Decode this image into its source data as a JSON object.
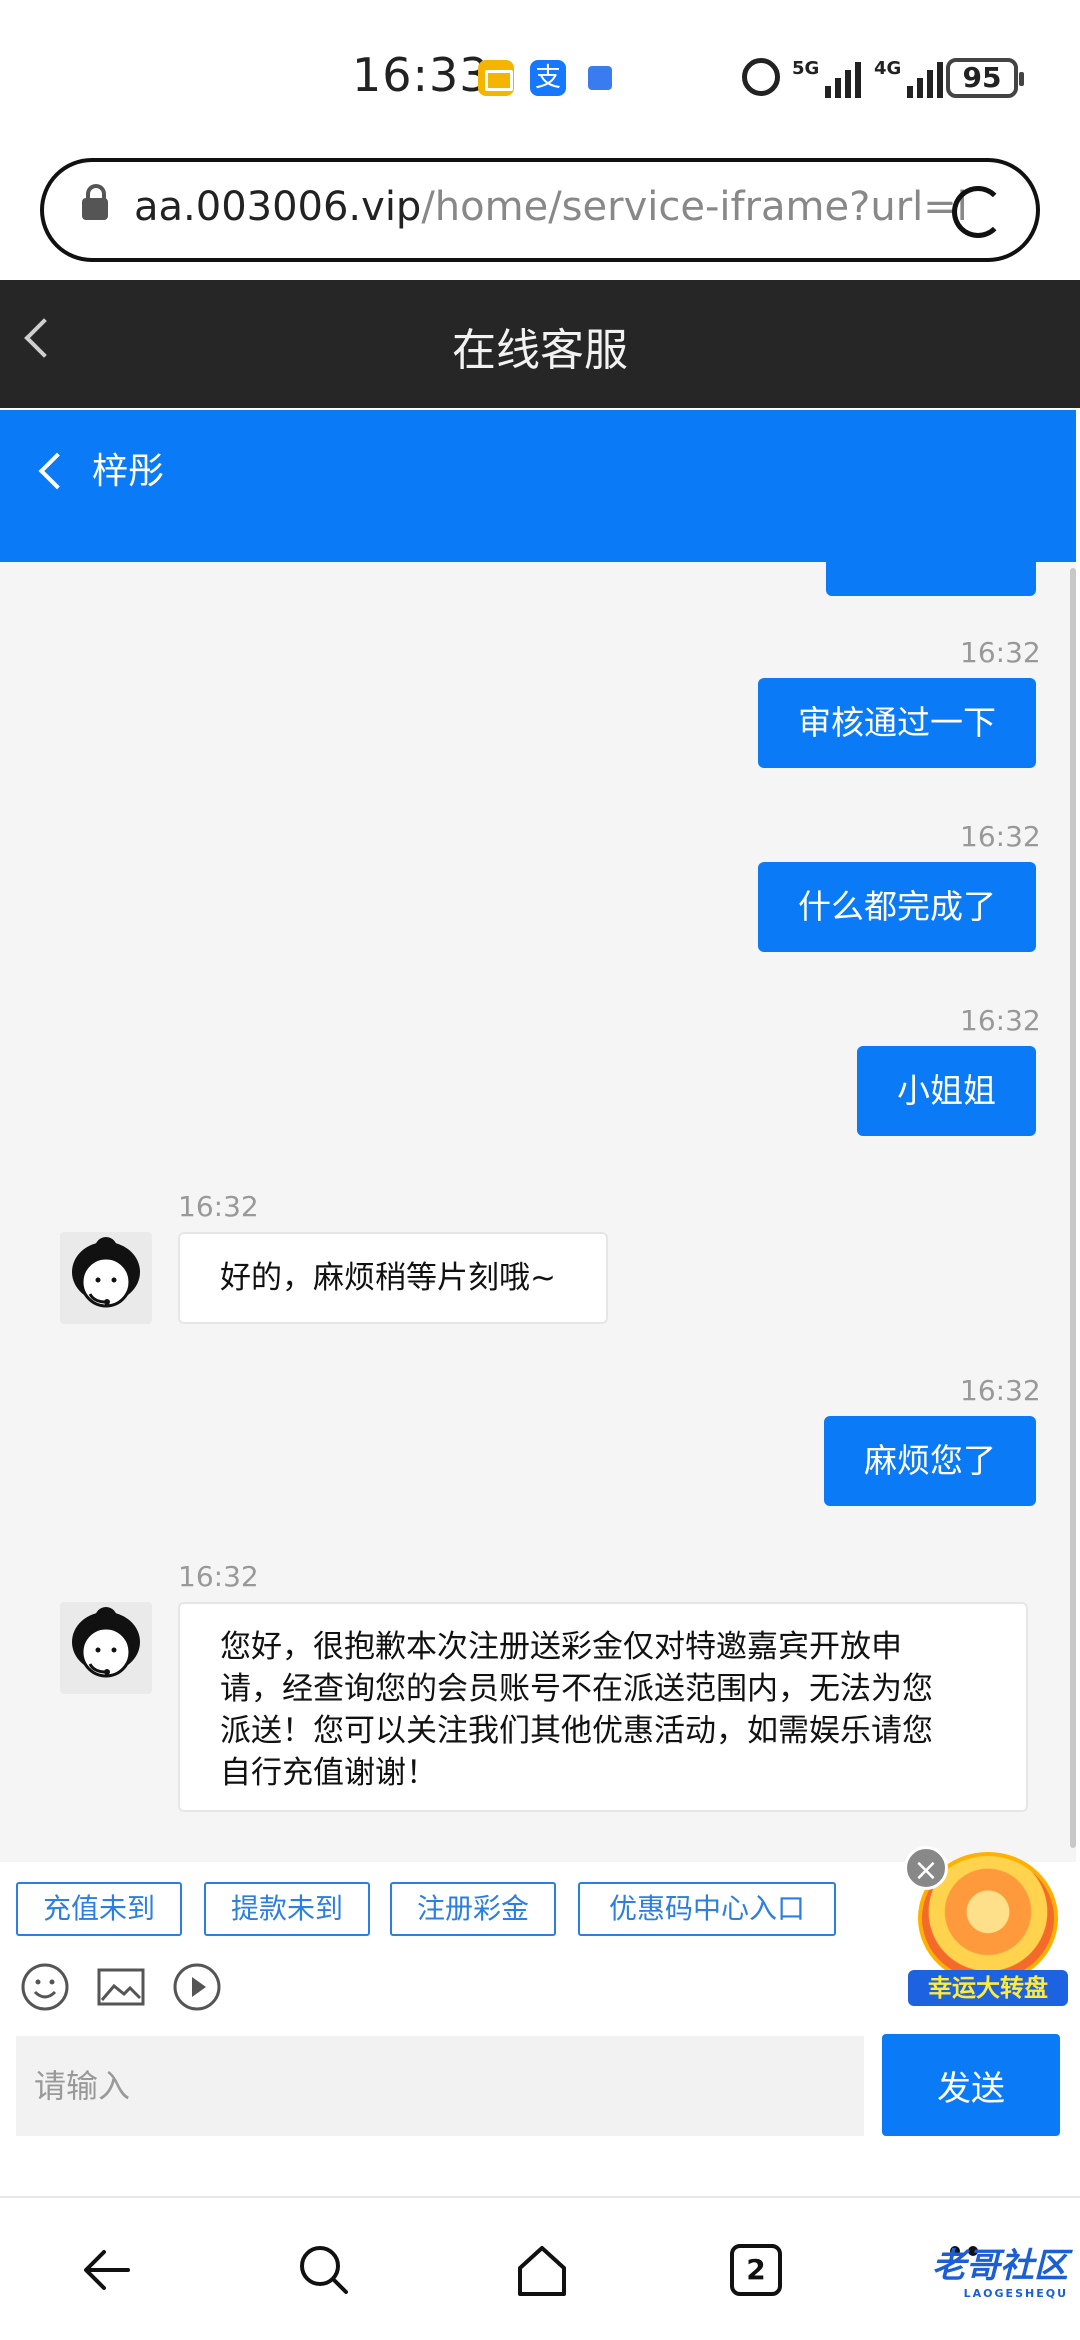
{
  "status_bar": {
    "time": "16:33",
    "net1": "5G",
    "net2": "4G",
    "battery": "95"
  },
  "browser": {
    "url_domain": "aa.003006.vip",
    "url_path": "/home/service-iframe?url=htt"
  },
  "app_header": {
    "title": "在线客服"
  },
  "chat_header": {
    "agent_name": "梓彤"
  },
  "messages": [
    {
      "side": "out",
      "time": "16:32",
      "text": "审核通过一下"
    },
    {
      "side": "out",
      "time": "16:32",
      "text": "什么都完成了"
    },
    {
      "side": "out",
      "time": "16:32",
      "text": "小姐姐"
    },
    {
      "side": "in",
      "time": "16:32",
      "text": "好的，麻烦稍等片刻哦~"
    },
    {
      "side": "out",
      "time": "16:32",
      "text": "麻烦您了"
    },
    {
      "side": "in",
      "time": "16:32",
      "lines": [
        "您好，很抱歉本次注册送彩金仅对特邀嘉宾开放申",
        "请，经查询您的会员账号不在派送范围内，无法为您",
        "派送！您可以关注我们其他优惠活动，如需娱乐请您",
        "自行充值谢谢！"
      ]
    }
  ],
  "quick_replies": [
    "充值未到",
    "提款未到",
    "注册彩金",
    "优惠码中心入口"
  ],
  "promo": {
    "label": "幸运大转盘",
    "close": "×"
  },
  "composer": {
    "placeholder": "请输入",
    "send_label": "发送"
  },
  "nav": {
    "tabs_count": "2"
  },
  "watermark": {
    "text": "老哥社区",
    "sub": "LAOGESHEQU"
  },
  "colors": {
    "brand_blue": "#0a7af7",
    "header_dark": "#262626"
  }
}
